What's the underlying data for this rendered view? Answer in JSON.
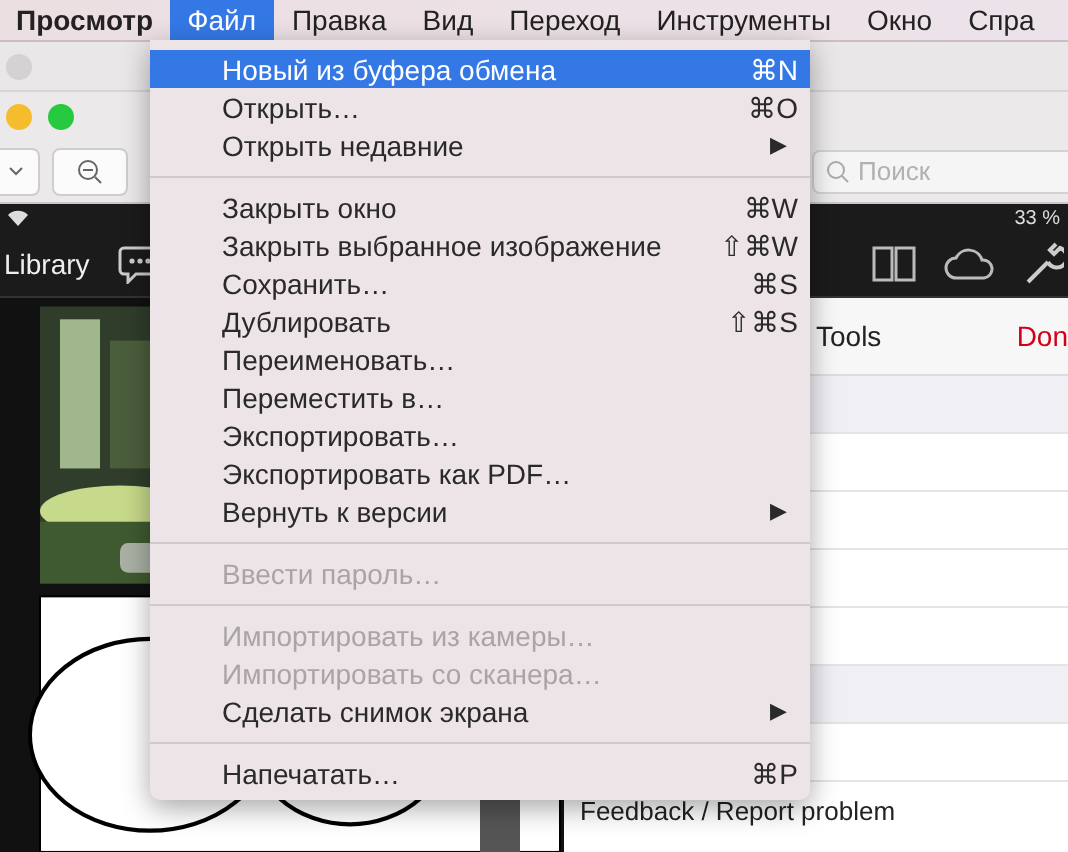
{
  "menu_bar": [
    {
      "label": "Просмотр",
      "kind": "app",
      "selected": false
    },
    {
      "label": "Файл",
      "kind": "menu",
      "selected": true
    },
    {
      "label": "Правка",
      "kind": "menu",
      "selected": false
    },
    {
      "label": "Вид",
      "kind": "menu",
      "selected": false
    },
    {
      "label": "Переход",
      "kind": "menu",
      "selected": false
    },
    {
      "label": "Инструменты",
      "kind": "menu",
      "selected": false
    },
    {
      "label": "Окно",
      "kind": "menu",
      "selected": false
    },
    {
      "label": "Спра",
      "kind": "menu",
      "selected": false
    }
  ],
  "file_menu": [
    {
      "kind": "item",
      "label": "Новый из буфера обмена",
      "shortcut": "⌘N",
      "selected": true,
      "disabled": false
    },
    {
      "kind": "item",
      "label": "Открыть…",
      "shortcut": "⌘O",
      "selected": false,
      "disabled": false
    },
    {
      "kind": "item",
      "label": "Открыть недавние",
      "submenu": "▶",
      "selected": false,
      "disabled": false
    },
    {
      "kind": "separator"
    },
    {
      "kind": "item",
      "label": "Закрыть окно",
      "shortcut": "⌘W",
      "selected": false,
      "disabled": false
    },
    {
      "kind": "item",
      "label": "Закрыть выбранное изображение",
      "shortcut": "⇧⌘W",
      "selected": false,
      "disabled": false
    },
    {
      "kind": "item",
      "label": "Сохранить…",
      "shortcut": "⌘S",
      "selected": false,
      "disabled": false
    },
    {
      "kind": "item",
      "label": "Дублировать",
      "shortcut": "⇧⌘S",
      "selected": false,
      "disabled": false
    },
    {
      "kind": "item",
      "label": "Переименовать…",
      "selected": false,
      "disabled": false
    },
    {
      "kind": "item",
      "label": "Переместить в…",
      "selected": false,
      "disabled": false
    },
    {
      "kind": "item",
      "label": "Экспортировать…",
      "selected": false,
      "disabled": false
    },
    {
      "kind": "item",
      "label": "Экспортировать как PDF…",
      "selected": false,
      "disabled": false
    },
    {
      "kind": "item",
      "label": "Вернуть к версии",
      "submenu": "▶",
      "selected": false,
      "disabled": false
    },
    {
      "kind": "separator"
    },
    {
      "kind": "item",
      "label": "Ввести пароль…",
      "selected": false,
      "disabled": true
    },
    {
      "kind": "separator"
    },
    {
      "kind": "item",
      "label": "Импортировать из камеры…",
      "selected": false,
      "disabled": true
    },
    {
      "kind": "item",
      "label": "Импортировать со сканера…",
      "selected": false,
      "disabled": true
    },
    {
      "kind": "item",
      "label": "Сделать снимок экрана",
      "submenu": "▶",
      "selected": false,
      "disabled": false
    },
    {
      "kind": "separator"
    },
    {
      "kind": "item",
      "label": "Напечатать…",
      "shortcut": "⌘P",
      "selected": false,
      "disabled": false
    }
  ],
  "toolbar": {
    "search_placeholder": "Поиск"
  },
  "document": {
    "status_battery": "33 %",
    "library_button": "Library",
    "tools_panel": {
      "title": "Tools",
      "action": "Don",
      "footer": "Feedback / Report problem"
    }
  }
}
